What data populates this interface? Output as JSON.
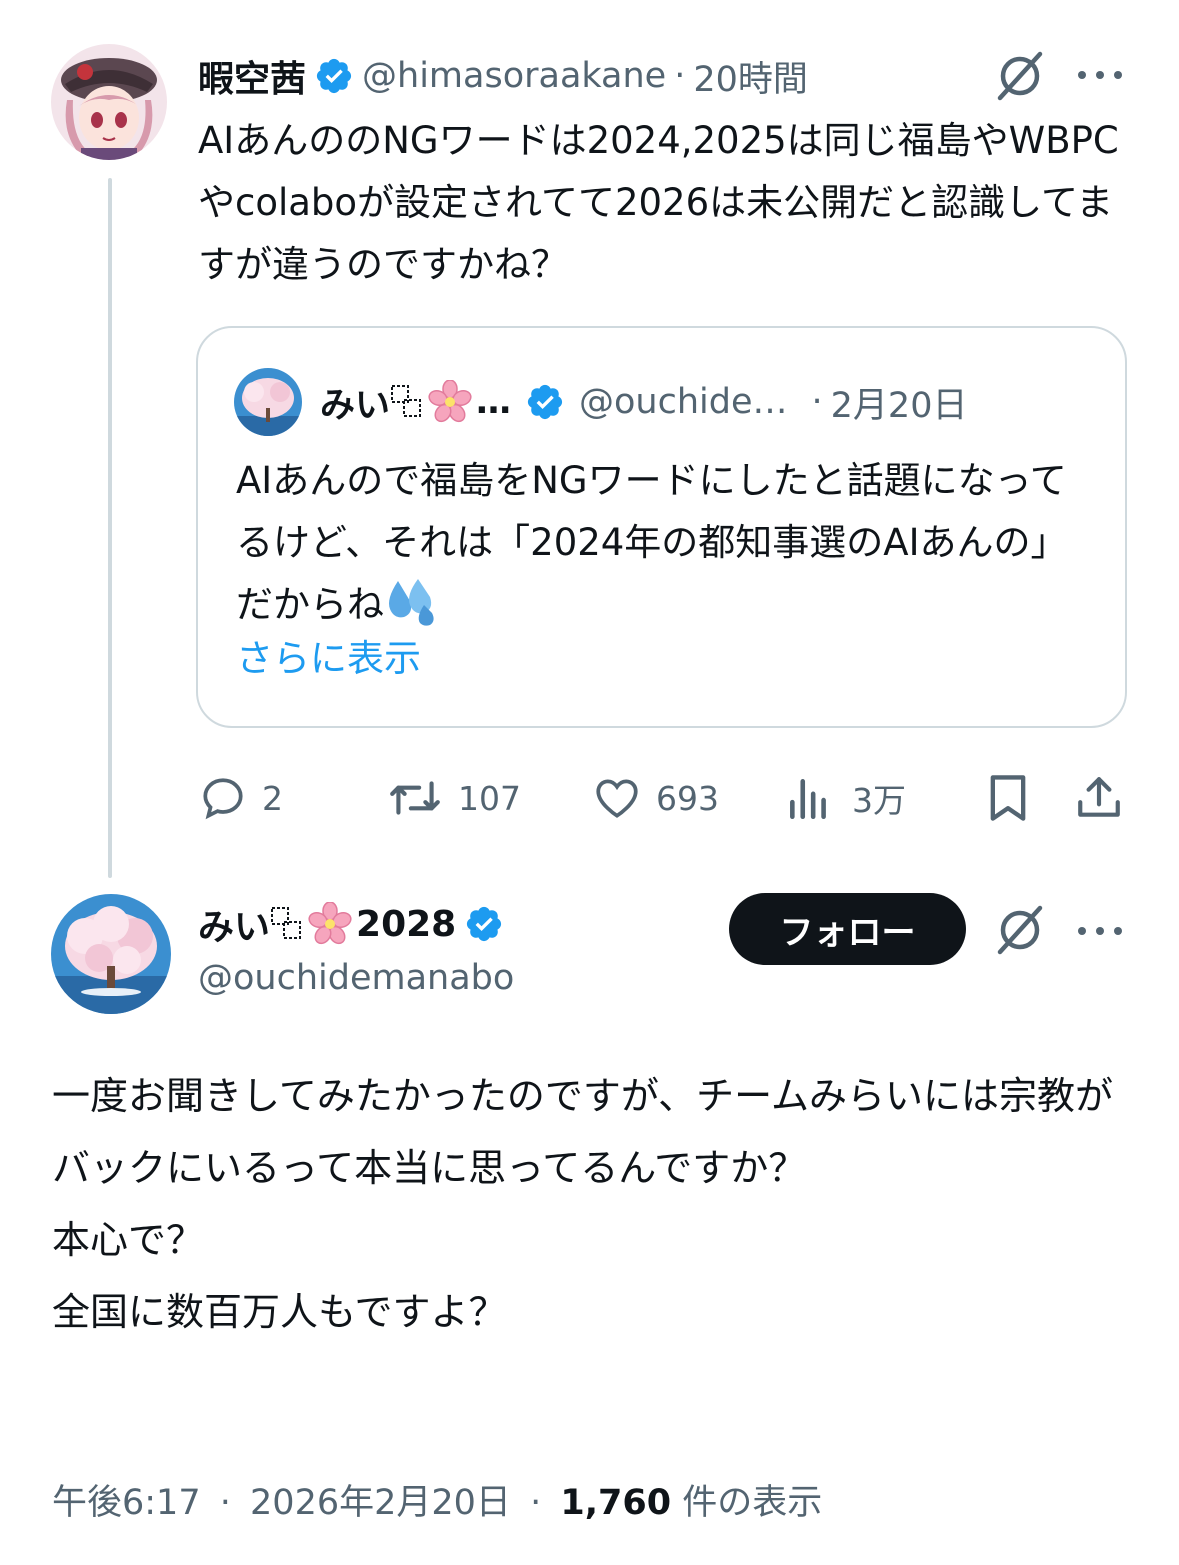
{
  "tweet1": {
    "name": "暇空茜",
    "handle": "@himasoraakane",
    "separator": "·",
    "time": "20時間",
    "text": "AIあんののNGワードは2024,2025は同じ福島やWBPCやcolaboが設定されてて2026は未公開だと認識してますが違うのですかね？",
    "quote": {
      "name_prefix": "みい",
      "name_suffix": "…",
      "handle": "@ouchide…",
      "separator": "·",
      "time": "2月20日",
      "text": "AIあんので福島をNGワードにしたと話題になってるけど、それは「2024年の都知事選のAIあんの」だからね",
      "show_more": "さらに表示"
    },
    "actions": {
      "replies": "2",
      "reposts": "107",
      "likes": "693",
      "views": "3万"
    }
  },
  "tweet2": {
    "name_prefix": "みい",
    "name_suffix": "2028",
    "handle": "@ouchidemanabo",
    "follow_label": "フォロー",
    "text": "一度お聞きしてみたかったのですが、チームみらいには宗教がバックにいるって本当に思ってるんですか？\n本心で？\n全国に数百万人もですよ？",
    "meta": {
      "time": "午後6:17",
      "separator": "·",
      "date": "2026年2月20日",
      "separator2": "·",
      "views_count": "1,760",
      "views_label": "件の表示"
    }
  },
  "icons": {
    "verified": "verified-badge-icon",
    "grok": "grok-icon",
    "more": "more-icon",
    "reply": "reply-icon",
    "repost": "repost-icon",
    "like": "like-icon",
    "views": "views-icon",
    "bookmark": "bookmark-icon",
    "share": "share-icon",
    "sakura": "sakura-emoji-icon",
    "drops": "sweat-droplets-emoji-icon"
  },
  "colors": {
    "text": "#0f1419",
    "secondary": "#536471",
    "accent": "#1d9bf0",
    "border": "#cfd9de"
  }
}
